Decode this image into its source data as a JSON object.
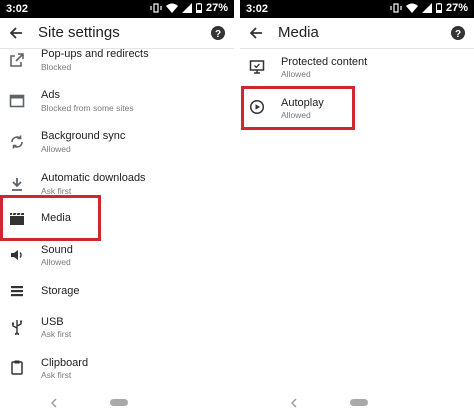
{
  "status_bar": {
    "time": "3:02",
    "battery": "27%"
  },
  "left_screen": {
    "title": "Site settings",
    "items": [
      {
        "label": "Pop-ups and redirects",
        "subtitle": "Blocked",
        "icon": "open-in-new-icon"
      },
      {
        "label": "Ads",
        "subtitle": "Blocked from some sites",
        "icon": "ads-icon"
      },
      {
        "label": "Background sync",
        "subtitle": "Allowed",
        "icon": "sync-icon"
      },
      {
        "label": "Automatic downloads",
        "subtitle": "Ask first",
        "icon": "download-icon"
      },
      {
        "label": "Media",
        "subtitle": "",
        "icon": "media-clapperboard-icon"
      },
      {
        "label": "Sound",
        "subtitle": "Allowed",
        "icon": "volume-icon"
      },
      {
        "label": "Storage",
        "subtitle": "",
        "icon": "storage-icon"
      },
      {
        "label": "USB",
        "subtitle": "Ask first",
        "icon": "usb-icon"
      },
      {
        "label": "Clipboard",
        "subtitle": "Ask first",
        "icon": "clipboard-icon"
      }
    ]
  },
  "right_screen": {
    "title": "Media",
    "items": [
      {
        "label": "Protected content",
        "subtitle": "Allowed",
        "icon": "protected-content-icon"
      },
      {
        "label": "Autoplay",
        "subtitle": "Allowed",
        "icon": "play-circle-icon"
      }
    ]
  },
  "colors": {
    "highlight": "#d0262d",
    "status_bar": "#000000",
    "icon": "#5f6368"
  }
}
